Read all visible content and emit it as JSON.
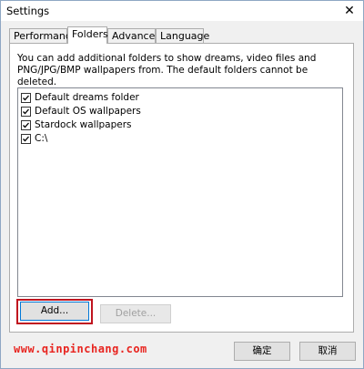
{
  "window": {
    "title": "Settings"
  },
  "tabs": [
    {
      "label": "Performance",
      "active": false
    },
    {
      "label": "Folders",
      "active": true
    },
    {
      "label": "Advanced",
      "active": false
    },
    {
      "label": "Language",
      "active": false
    }
  ],
  "folders": {
    "description": "You can add additional folders to show dreams, video files and PNG/JPG/BMP wallpapers from.  The default folders cannot be deleted.",
    "items": [
      {
        "label": "Default dreams folder",
        "checked": true
      },
      {
        "label": "Default OS wallpapers",
        "checked": true
      },
      {
        "label": "Stardock wallpapers",
        "checked": true
      },
      {
        "label": "C:\\",
        "checked": true
      }
    ],
    "add_label": "Add...",
    "delete_label": "Delete..."
  },
  "footer": {
    "watermark": "www.qinpinchang.com",
    "ok_label": "确定",
    "cancel_label": "取消"
  },
  "colors": {
    "highlight": "#c0141f",
    "watermark": "#e8241f"
  }
}
